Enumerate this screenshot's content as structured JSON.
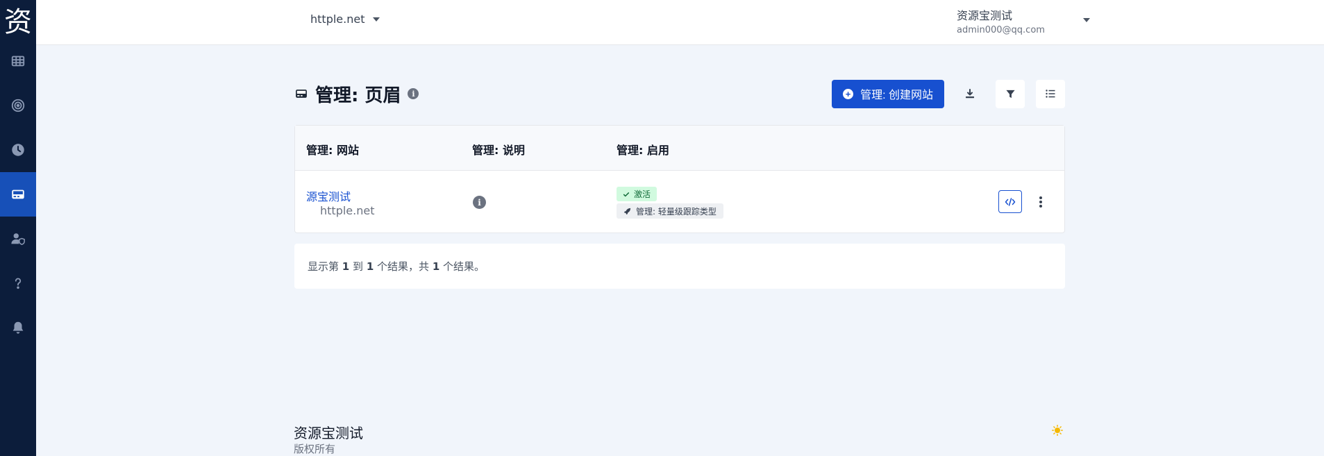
{
  "sidebar": {
    "logo": "资",
    "items": [
      {
        "icon": "grid-icon"
      },
      {
        "icon": "target-icon"
      },
      {
        "icon": "clock-icon"
      },
      {
        "icon": "card-icon",
        "active": true
      },
      {
        "icon": "user-shield-icon"
      },
      {
        "icon": "help-icon"
      },
      {
        "icon": "bell-icon"
      }
    ]
  },
  "topbar": {
    "site": "httple.net",
    "user_name": "资源宝测试",
    "user_email": "admin000@qq.com"
  },
  "page": {
    "title": "管理: 页眉",
    "create_button": "管理: 创建网站"
  },
  "table": {
    "headers": [
      "管理: 网站",
      "管理: 说明",
      "管理: 启用"
    ],
    "row": {
      "site_name": "源宝测试",
      "site_domain": "httple.net",
      "status": "激活",
      "type": "管理: 轻量级跟踪类型"
    }
  },
  "pagination": {
    "prefix": "显示第",
    "from": "1",
    "to_label": "到",
    "to": "1",
    "mid": "个结果，共",
    "total": "1",
    "suffix": "个结果。"
  },
  "footer": {
    "title": "资源宝测试",
    "subtitle": "版权所有"
  },
  "colors": {
    "sidebar_bg": "#0c1d3b",
    "accent": "#1750d0",
    "page_bg": "#f1f5fb",
    "success_bg": "#d1fadf",
    "sun": "#f5b800"
  }
}
